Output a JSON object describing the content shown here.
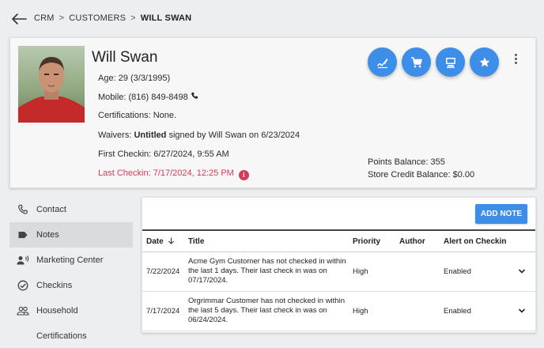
{
  "breadcrumb": {
    "items": [
      "CRM",
      "CUSTOMERS"
    ],
    "separator": ">",
    "current": "WILL SWAN"
  },
  "profile": {
    "name": "Will Swan",
    "age": "Age: 29 (3/3/1995)",
    "mobile": "Mobile: (816) 849-8498",
    "certifications": "Certifications: None.",
    "waivers_prefix": "Waivers: ",
    "waivers_bold": "Untitled",
    "waivers_suffix": " signed by Will Swan on 6/23/2024",
    "first_checkin": "First Checkin: 6/27/2024, 9:55 AM",
    "last_checkin": "Last Checkin: 7/17/2024, 12:25 PM",
    "points_balance": "Points Balance: 355",
    "store_credit": "Store Credit Balance: $0.00",
    "info_glyph": "i"
  },
  "actions": [
    {
      "icon": "sign-waiver-icon"
    },
    {
      "icon": "cart-icon"
    },
    {
      "icon": "pos-terminal-icon"
    },
    {
      "icon": "star-icon"
    }
  ],
  "sidebar": {
    "items": [
      {
        "label": "Contact",
        "icon": "phone-icon"
      },
      {
        "label": "Notes",
        "icon": "label-icon",
        "active": true
      },
      {
        "label": "Marketing Center",
        "icon": "megaphone-person-icon"
      },
      {
        "label": "Checkins",
        "icon": "check-circle-icon"
      },
      {
        "label": "Household",
        "icon": "group-icon"
      },
      {
        "label": "Certifications",
        "icon": ""
      }
    ]
  },
  "notes": {
    "add_label": "ADD NOTE",
    "columns": {
      "date": "Date",
      "title": "Title",
      "priority": "Priority",
      "author": "Author",
      "alert": "Alert on Checkin"
    },
    "rows": [
      {
        "date": "7/22/2024",
        "title_lines": [
          "Acme Gym Customer has not checked in within",
          "the last 1 days. Their last check in was on",
          "07/17/2024."
        ],
        "priority": "High",
        "author": "",
        "alert": "Enabled"
      },
      {
        "date": "7/17/2024",
        "title_lines": [
          "Orgrimmar Customer has not checked in within",
          "the last 5 days. Their last check in was on",
          "06/24/2024."
        ],
        "priority": "High",
        "author": "",
        "alert": "Enabled"
      }
    ]
  },
  "colors": {
    "accent": "#3d8ee9",
    "alert": "#d63a5a",
    "active_bg": "#d9dbde"
  }
}
